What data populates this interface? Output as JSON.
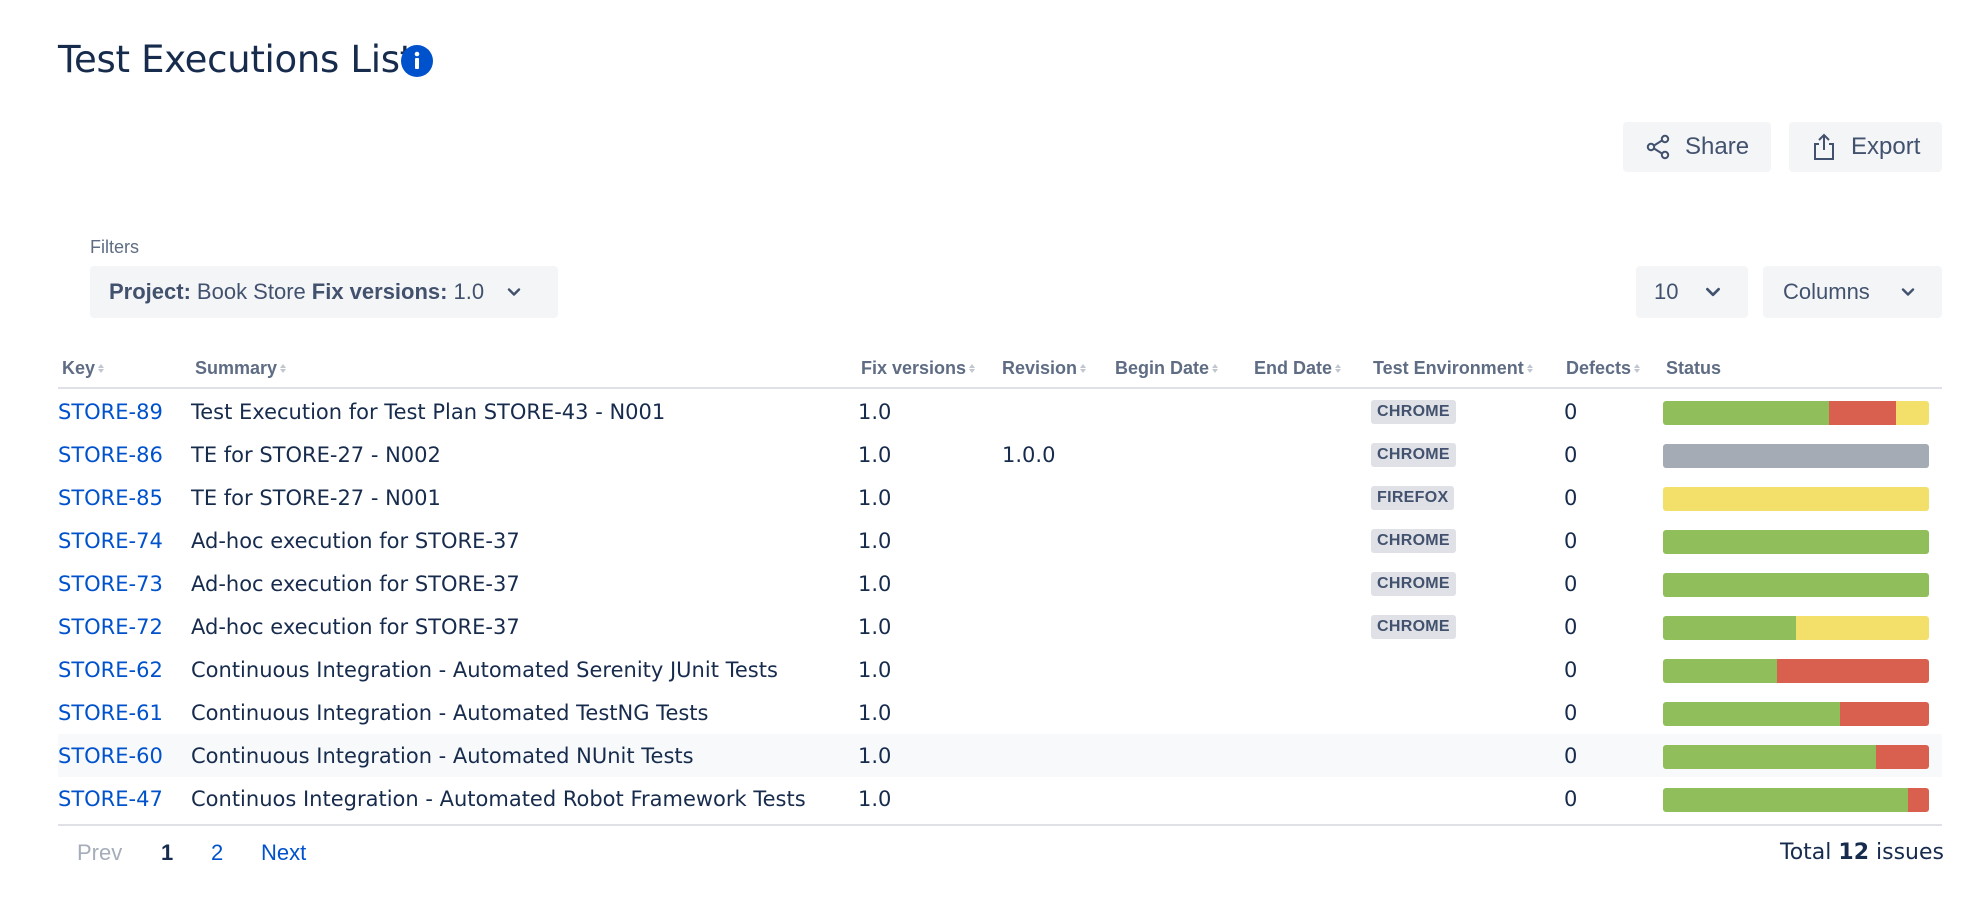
{
  "page": {
    "title": "Test Executions List"
  },
  "toolbar": {
    "share_label": "Share",
    "export_label": "Export"
  },
  "filters": {
    "label": "Filters",
    "project_key": "Project:",
    "project_value": "Book Store",
    "fixversions_key": "Fix versions:",
    "fixversions_value": "1.0"
  },
  "page_size": "10",
  "columns_label": "Columns",
  "table": {
    "headers": {
      "key": "Key",
      "summary": "Summary",
      "fix_versions": "Fix versions",
      "revision": "Revision",
      "begin_date": "Begin Date",
      "end_date": "End Date",
      "test_environment": "Test Environment",
      "defects": "Defects",
      "status": "Status"
    },
    "rows": [
      {
        "key": "STORE-89",
        "summary": "Test Execution for Test Plan STORE-43 - N001",
        "fix": "1.0",
        "revision": "",
        "env": "CHROME",
        "defects": "0",
        "status": [
          {
            "color": "#8fbe5b",
            "pct": 62.5
          },
          {
            "color": "#d9604f",
            "pct": 25
          },
          {
            "color": "#f2e06b",
            "pct": 12.5
          }
        ]
      },
      {
        "key": "STORE-86",
        "summary": "TE for STORE-27 - N002",
        "fix": "1.0",
        "revision": "1.0.0",
        "env": "CHROME",
        "defects": "0",
        "status": [
          {
            "color": "#a5abb5",
            "pct": 100
          }
        ]
      },
      {
        "key": "STORE-85",
        "summary": "TE for STORE-27 - N001",
        "fix": "1.0",
        "revision": "",
        "env": "FIREFOX",
        "defects": "0",
        "status": [
          {
            "color": "#f2e06b",
            "pct": 100
          }
        ]
      },
      {
        "key": "STORE-74",
        "summary": "Ad-hoc execution for STORE-37",
        "fix": "1.0",
        "revision": "",
        "env": "CHROME",
        "defects": "0",
        "status": [
          {
            "color": "#8fbe5b",
            "pct": 100
          }
        ]
      },
      {
        "key": "STORE-73",
        "summary": "Ad-hoc execution for STORE-37",
        "fix": "1.0",
        "revision": "",
        "env": "CHROME",
        "defects": "0",
        "status": [
          {
            "color": "#8fbe5b",
            "pct": 100
          }
        ]
      },
      {
        "key": "STORE-72",
        "summary": "Ad-hoc execution for STORE-37",
        "fix": "1.0",
        "revision": "",
        "env": "CHROME",
        "defects": "0",
        "status": [
          {
            "color": "#8fbe5b",
            "pct": 50
          },
          {
            "color": "#f2e06b",
            "pct": 50
          }
        ]
      },
      {
        "key": "STORE-62",
        "summary": "Continuous Integration - Automated Serenity JUnit Tests",
        "fix": "1.0",
        "revision": "",
        "env": "",
        "defects": "0",
        "status": [
          {
            "color": "#8fbe5b",
            "pct": 42.9
          },
          {
            "color": "#d9604f",
            "pct": 57.1
          }
        ]
      },
      {
        "key": "STORE-61",
        "summary": "Continuous Integration - Automated TestNG Tests",
        "fix": "1.0",
        "revision": "",
        "env": "",
        "defects": "0",
        "status": [
          {
            "color": "#8fbe5b",
            "pct": 66.7
          },
          {
            "color": "#d9604f",
            "pct": 33.3
          }
        ]
      },
      {
        "key": "STORE-60",
        "summary": "Continuous Integration - Automated NUnit Tests",
        "fix": "1.0",
        "revision": "",
        "env": "",
        "defects": "0",
        "status": [
          {
            "color": "#8fbe5b",
            "pct": 80
          },
          {
            "color": "#d9604f",
            "pct": 20
          }
        ]
      },
      {
        "key": "STORE-47",
        "summary": "Continuos Integration - Automated Robot Framework Tests",
        "fix": "1.0",
        "revision": "",
        "env": "",
        "defects": "0",
        "status": [
          {
            "color": "#8fbe5b",
            "pct": 92
          },
          {
            "color": "#d9604f",
            "pct": 8
          }
        ]
      }
    ]
  },
  "pagination": {
    "prev": "Prev",
    "page1": "1",
    "page2": "2",
    "next": "Next"
  },
  "total": {
    "prefix": "Total",
    "count": "12",
    "suffix": "issues"
  },
  "icons": {
    "info": "info-icon",
    "share": "share-icon",
    "export": "export-icon",
    "chevron": "chevron-down-icon",
    "sort": "sort-icon"
  },
  "colors": {
    "link": "#0052cc",
    "pass": "#8fbe5b",
    "fail": "#d9604f",
    "executing": "#f2e06b",
    "todo": "#a5abb5"
  }
}
